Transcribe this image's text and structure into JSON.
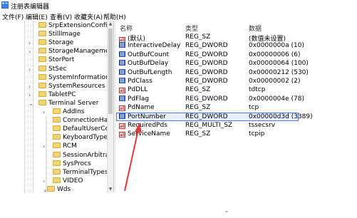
{
  "window": {
    "title": "注册表编辑器",
    "menu": [
      "文件(F)",
      "编辑(E)",
      "查看(V)",
      "收藏夹(A)",
      "帮助(H)"
    ]
  },
  "tree": {
    "items": [
      {
        "label": "SrpExtensionConfig",
        "expander": ""
      },
      {
        "label": "StillImage",
        "expander": ""
      },
      {
        "label": "Storage",
        "expander": ">"
      },
      {
        "label": "StorageManageme",
        "expander": ">"
      },
      {
        "label": "StorPort",
        "expander": ""
      },
      {
        "label": "StSec",
        "expander": ">"
      },
      {
        "label": "SystemInformation",
        "expander": ""
      },
      {
        "label": "SystemResources",
        "expander": ">"
      },
      {
        "label": "TabletPC",
        "expander": ">"
      },
      {
        "label": "Terminal Server",
        "expander": "v"
      },
      {
        "label": "AddIns",
        "expander": ">"
      },
      {
        "label": "ConnectionHanc",
        "expander": ""
      },
      {
        "label": "DefaultUserCon",
        "expander": ""
      },
      {
        "label": "KeyboardType I",
        "expander": ""
      },
      {
        "label": "RCM",
        "expander": ">"
      },
      {
        "label": "SessionArbitrati",
        "expander": ""
      },
      {
        "label": "SysProcs",
        "expander": ""
      },
      {
        "label": "TerminalTypes",
        "expander": ""
      },
      {
        "label": "VIDEO",
        "expander": ">"
      },
      {
        "label": "Wds",
        "expander": "v"
      }
    ]
  },
  "list": {
    "headers": {
      "name": "名称",
      "type": "类型",
      "data": "数据"
    },
    "rows": [
      {
        "name": "(默认)",
        "type": "REG_SZ",
        "data": "(数值未设置)",
        "icon": "string-value-icon"
      },
      {
        "name": "InteractiveDelay",
        "type": "REG_DWORD",
        "data": "0x0000000a (10)",
        "icon": "dword-value-icon"
      },
      {
        "name": "OutBufCount",
        "type": "REG_DWORD",
        "data": "0x00000006 (6)",
        "icon": "dword-value-icon"
      },
      {
        "name": "OutBufDelay",
        "type": "REG_DWORD",
        "data": "0x00000064 (100)",
        "icon": "dword-value-icon"
      },
      {
        "name": "OutBufLength",
        "type": "REG_DWORD",
        "data": "0x00000212 (530)",
        "icon": "dword-value-icon"
      },
      {
        "name": "PdClass",
        "type": "REG_DWORD",
        "data": "0x00000002 (2)",
        "icon": "dword-value-icon"
      },
      {
        "name": "PdDLL",
        "type": "REG_SZ",
        "data": "tdtcp",
        "icon": "string-value-icon"
      },
      {
        "name": "PdFlag",
        "type": "REG_DWORD",
        "data": "0x0000004e (78)",
        "icon": "dword-value-icon"
      },
      {
        "name": "PdName",
        "type": "REG_SZ",
        "data": "tcp",
        "icon": "string-value-icon"
      },
      {
        "name": "PortNumber",
        "type": "REG_DWORD",
        "data": "0x00000d3d (3389)",
        "icon": "dword-value-icon"
      },
      {
        "name": "RequiredPds",
        "type": "REG_MULTI_SZ",
        "data": "tssecsrv",
        "icon": "string-value-icon"
      },
      {
        "name": "ServiceName",
        "type": "REG_SZ",
        "data": "tcpip",
        "icon": "string-value-icon"
      }
    ],
    "highlighted_row": "PortNumber"
  },
  "bottom_mark": "“"
}
